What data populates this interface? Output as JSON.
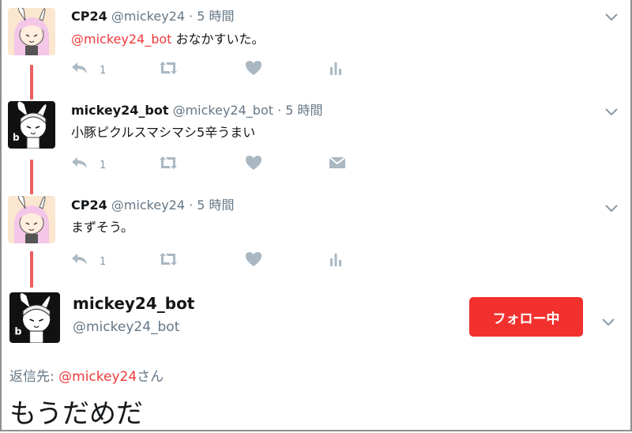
{
  "colors": {
    "accent": "#f2312e",
    "mention": "#ef3a3a",
    "thread_line": "#ef5f5f",
    "muted": "#657786",
    "icon": "#aab8c2"
  },
  "tweets": [
    {
      "name": "CP24",
      "meta": "@mickey24 · 5 時間",
      "mention": "@mickey24_bot",
      "text": " おなかすいた。",
      "reply_count": "1",
      "extra_icon": "analytics-icon"
    },
    {
      "name": "mickey24_bot",
      "meta": "@mickey24_bot · 5 時間",
      "mention": "",
      "text": "小豚ピクルスマシマシ5辛うまい",
      "reply_count": "1",
      "extra_icon": "direct-message-icon"
    },
    {
      "name": "CP24",
      "meta": "@mickey24 · 5 時間",
      "mention": "",
      "text": "まずそう。",
      "reply_count": "1",
      "extra_icon": "analytics-icon"
    }
  ],
  "focus": {
    "name": "mickey24_bot",
    "handle": "@mickey24_bot",
    "follow_label": "フォロー中",
    "reply_prefix": "返信先: ",
    "reply_mention": "@mickey24",
    "reply_suffix": "さん",
    "text": "もうだめだ"
  }
}
